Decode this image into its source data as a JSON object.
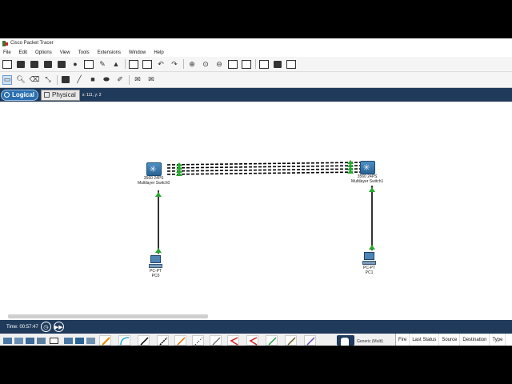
{
  "window": {
    "title": "Cisco Packet Tracer"
  },
  "menu": [
    "File",
    "Edit",
    "Options",
    "View",
    "Tools",
    "Extensions",
    "Window",
    "Help"
  ],
  "tabs": {
    "logical": "Logical",
    "physical": "Physical",
    "coords": "x: 111, y: 2"
  },
  "devices": {
    "switch0": {
      "model": "3560 24PS",
      "name": "Multilayer Switch0"
    },
    "switch1": {
      "model": "3560 24PS",
      "name": "Multilayer Switch1"
    },
    "pc0": {
      "model": "PC-PT",
      "name": "PC0"
    },
    "pc1": {
      "model": "PC-PT",
      "name": "PC1"
    }
  },
  "status": {
    "time": "Time: 00:57:47"
  },
  "device_list": {
    "selected": "Generic (Multi)"
  },
  "pdu_columns": [
    "Fire",
    "Last Status",
    "Source",
    "Destination",
    "Type"
  ],
  "colors": {
    "status_bar": "#1f3a5a",
    "link_up": "#27a82e",
    "cable": "#000000"
  }
}
